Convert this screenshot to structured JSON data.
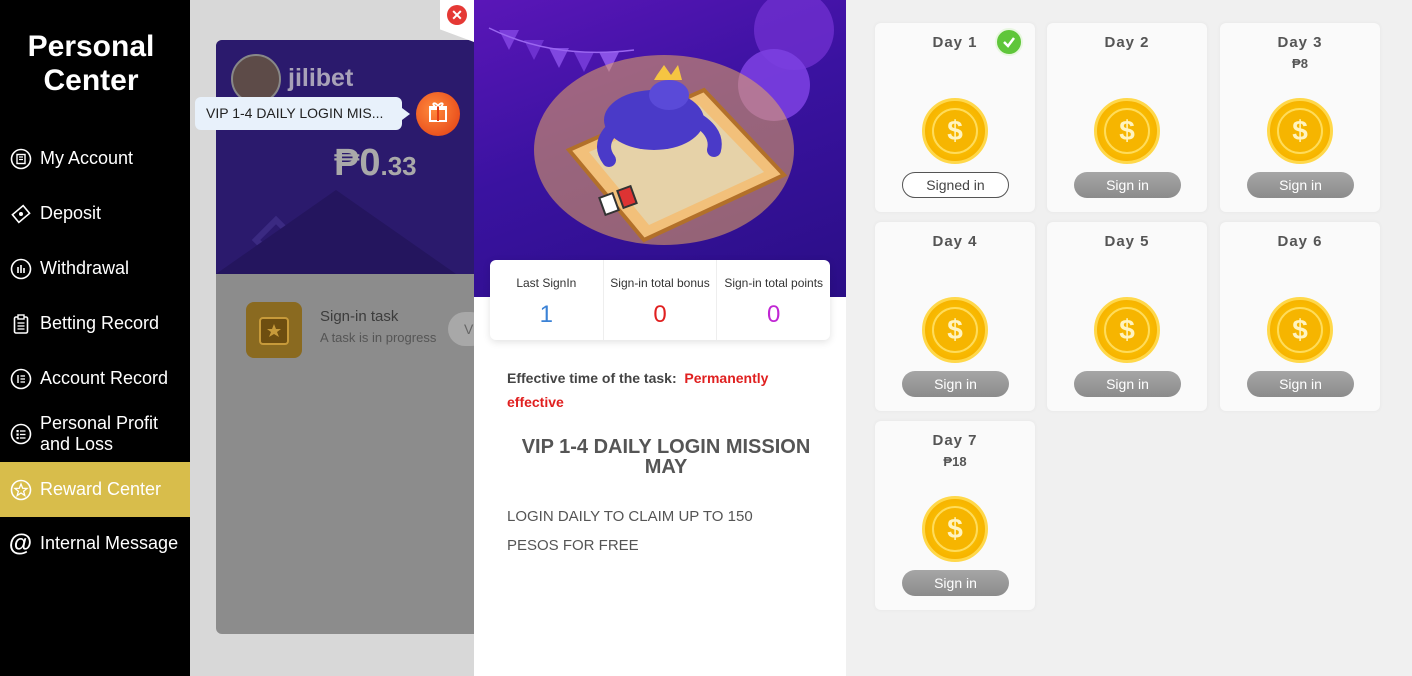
{
  "sidebar": {
    "title_line1": "Personal",
    "title_line2": "Center",
    "items": [
      {
        "label": "My Account",
        "icon": "account-icon"
      },
      {
        "label": "Deposit",
        "icon": "deposit-icon"
      },
      {
        "label": "Withdrawal",
        "icon": "withdrawal-icon"
      },
      {
        "label": "Betting Record",
        "icon": "clipboard-icon"
      },
      {
        "label": "Account Record",
        "icon": "record-icon"
      },
      {
        "label": "Personal Profit and Loss",
        "label_line1": "Personal Profit",
        "label_line2": "and Loss",
        "icon": "list-icon"
      },
      {
        "label": "Reward Center",
        "icon": "star-icon",
        "active": true
      },
      {
        "label": "Internal Message",
        "icon": "at-icon"
      }
    ],
    "active_color": "#d8bd4b"
  },
  "background": {
    "username": "jilibet",
    "balance_main": "₱0",
    "balance_decimal": ".33",
    "sign_task_title": "Sign-in task",
    "sign_task_subtitle": "A task is in progress",
    "sign_task_button": "V"
  },
  "tooltip": {
    "text": "VIP 1-4 DAILY LOGIN MIS..."
  },
  "mission": {
    "stats": [
      {
        "label": "Last SignIn",
        "value": "1",
        "color": "#3b82d6"
      },
      {
        "label": "Sign-in total bonus",
        "value": "0",
        "color": "#e02020"
      },
      {
        "label": "Sign-in total points",
        "value": "0",
        "color": "#c026d3"
      }
    ],
    "effective_label": "Effective time of the task:",
    "effective_value": "Permanently effective",
    "title_line1": "VIP 1-4 DAILY LOGIN MISSION",
    "title_line2": "MAY",
    "description_line1": "LOGIN DAILY TO CLAIM UP TO 150",
    "description_line2": "PESOS FOR FREE"
  },
  "days": [
    {
      "title": "Day 1",
      "reward": "",
      "button": "Signed in",
      "signed": true
    },
    {
      "title": "Day 2",
      "reward": "",
      "button": "Sign in",
      "signed": false
    },
    {
      "title": "Day 3",
      "reward": "₱8",
      "button": "Sign in",
      "signed": false
    },
    {
      "title": "Day 4",
      "reward": "",
      "button": "Sign in",
      "signed": false
    },
    {
      "title": "Day 5",
      "reward": "",
      "button": "Sign in",
      "signed": false
    },
    {
      "title": "Day 6",
      "reward": "",
      "button": "Sign in",
      "signed": false
    },
    {
      "title": "Day 7",
      "reward": "₱18",
      "button": "Sign in",
      "signed": false
    }
  ],
  "coin_symbol": "$"
}
